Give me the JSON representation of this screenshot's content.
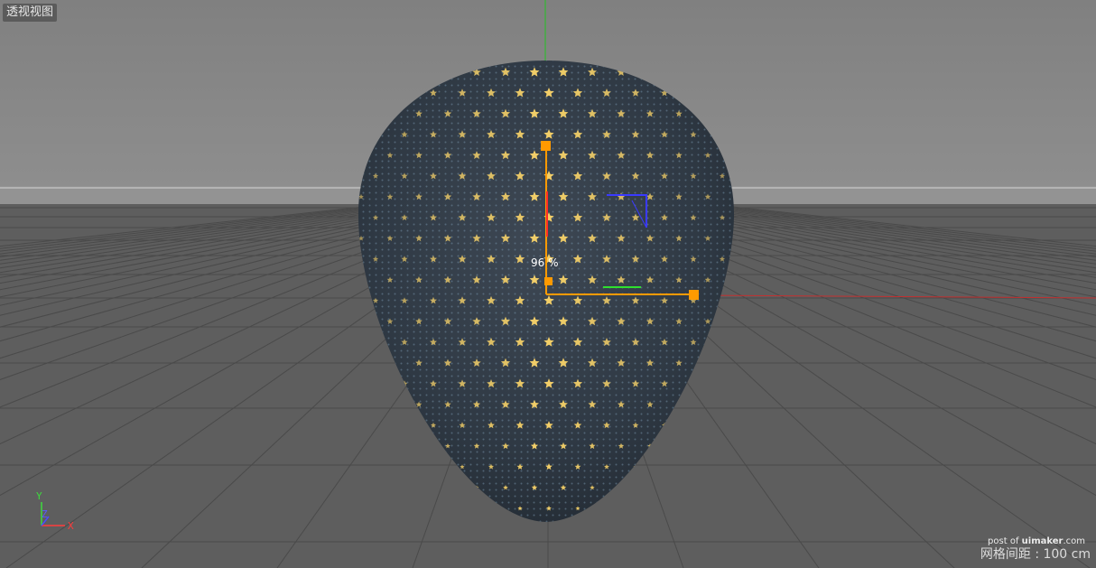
{
  "viewport": {
    "view_name": "透视视图",
    "scale_percent": "96 %",
    "grid_spacing": "网格间距 : 100 cm"
  },
  "axes": {
    "y": "Y",
    "z": "Z",
    "x": "X"
  },
  "watermark": {
    "prefix": "post of ",
    "site": "uimaker",
    "suffix": ".com"
  },
  "colors": {
    "background_top": "#8a8a8a",
    "floor": "#5d5d5d",
    "object_base": "#2f3944",
    "star_highlight": "#ffd86a",
    "gizmo": "#ff9a00",
    "axis_x": "#ff3b3b",
    "axis_y": "#3ddc3d",
    "axis_z": "#3b3bff"
  },
  "object": {
    "name": "egg-shaped-star-lattice",
    "fill_pattern": "star-icon"
  }
}
